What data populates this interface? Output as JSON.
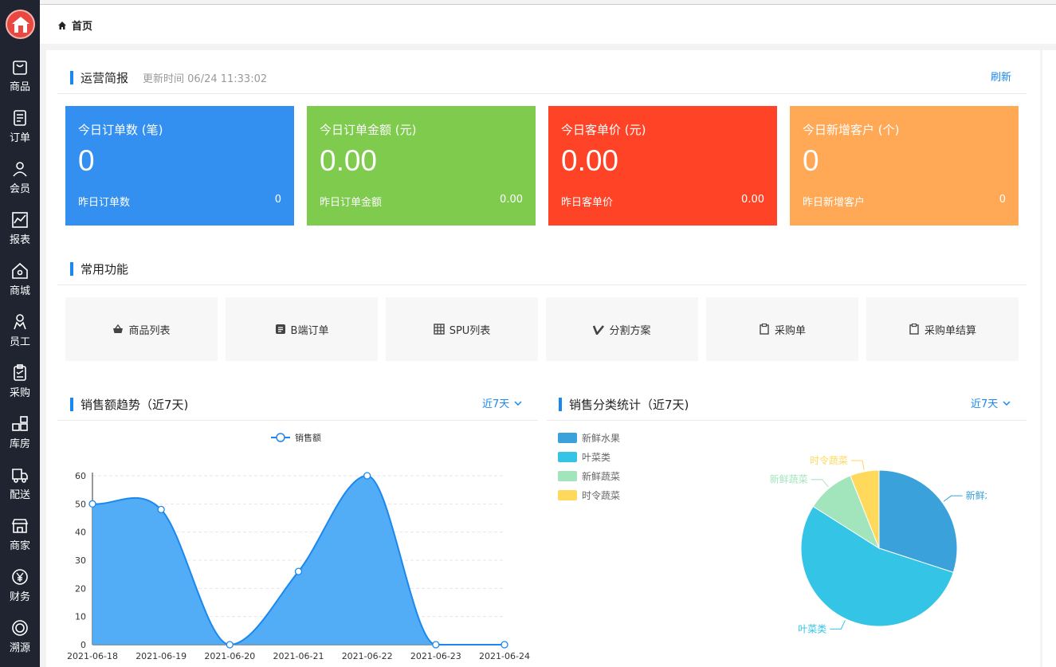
{
  "header": {
    "breadcrumb": "首页"
  },
  "sidebar": {
    "items": [
      {
        "label": "商品",
        "icon": "bag-icon"
      },
      {
        "label": "订单",
        "icon": "document-icon"
      },
      {
        "label": "会员",
        "icon": "user-icon"
      },
      {
        "label": "报表",
        "icon": "chart-icon"
      },
      {
        "label": "商城",
        "icon": "home-icon"
      },
      {
        "label": "员工",
        "icon": "staff-icon"
      },
      {
        "label": "采购",
        "icon": "clipboard-icon"
      },
      {
        "label": "库房",
        "icon": "warehouse-icon"
      },
      {
        "label": "配送",
        "icon": "truck-icon"
      },
      {
        "label": "商家",
        "icon": "store-icon"
      },
      {
        "label": "财务",
        "icon": "yen-icon"
      },
      {
        "label": "溯源",
        "icon": "trace-icon"
      }
    ]
  },
  "report": {
    "title": "运营简报",
    "update_time": "更新时间 06/24 11:33:02",
    "refresh_label": "刷新",
    "cards": [
      {
        "label": "今日订单数 (笔)",
        "value": "0",
        "y_label": "昨日订单数",
        "y_value": "0",
        "color": "#3390f0"
      },
      {
        "label": "今日订单金额 (元)",
        "value": "0.00",
        "y_label": "昨日订单金额",
        "y_value": "0.00",
        "color": "#7ecb4e"
      },
      {
        "label": "今日客单价 (元)",
        "value": "0.00",
        "y_label": "昨日客单价",
        "y_value": "0.00",
        "color": "#ff4327"
      },
      {
        "label": "今日新增客户 (个)",
        "value": "0",
        "y_label": "昨日新增客户",
        "y_value": "0",
        "color": "#ffa855"
      }
    ]
  },
  "functions": {
    "title": "常用功能",
    "items": [
      {
        "label": "商品列表",
        "icon": "basket-icon"
      },
      {
        "label": "B端订单",
        "icon": "list-icon"
      },
      {
        "label": "SPU列表",
        "icon": "grid-icon"
      },
      {
        "label": "分割方案",
        "icon": "v-icon"
      },
      {
        "label": "采购单",
        "icon": "clipboard-icon"
      },
      {
        "label": "采购单结算",
        "icon": "clipboard-icon"
      }
    ]
  },
  "sales_trend": {
    "title": "销售额趋势（近7天)",
    "range": "近7天"
  },
  "category_stats": {
    "title": "销售分类统计（近7天)",
    "range": "近7天"
  },
  "chart_data": [
    {
      "type": "area",
      "x": [
        "2021-06-18",
        "2021-06-19",
        "2021-06-20",
        "2021-06-21",
        "2021-06-22",
        "2021-06-23",
        "2021-06-24"
      ],
      "series": [
        {
          "name": "销售额",
          "values": [
            50,
            48,
            0,
            26,
            60,
            0,
            0
          ],
          "color": "#1a88ee"
        }
      ],
      "ylim": [
        0,
        60
      ],
      "yticks": [
        0,
        10,
        20,
        30,
        40,
        50,
        60
      ],
      "legend": "top-center",
      "grid": true
    },
    {
      "type": "pie",
      "slices": [
        {
          "name": "新鲜水果",
          "value": 30,
          "color": "#3aa1db"
        },
        {
          "name": "叶菜类",
          "value": 54,
          "color": "#33c4e6"
        },
        {
          "name": "新鲜蔬菜",
          "value": 10,
          "color": "#a2e5bc"
        },
        {
          "name": "时令蔬菜",
          "value": 6,
          "color": "#ffd95c"
        }
      ],
      "legend": "top-left"
    }
  ]
}
